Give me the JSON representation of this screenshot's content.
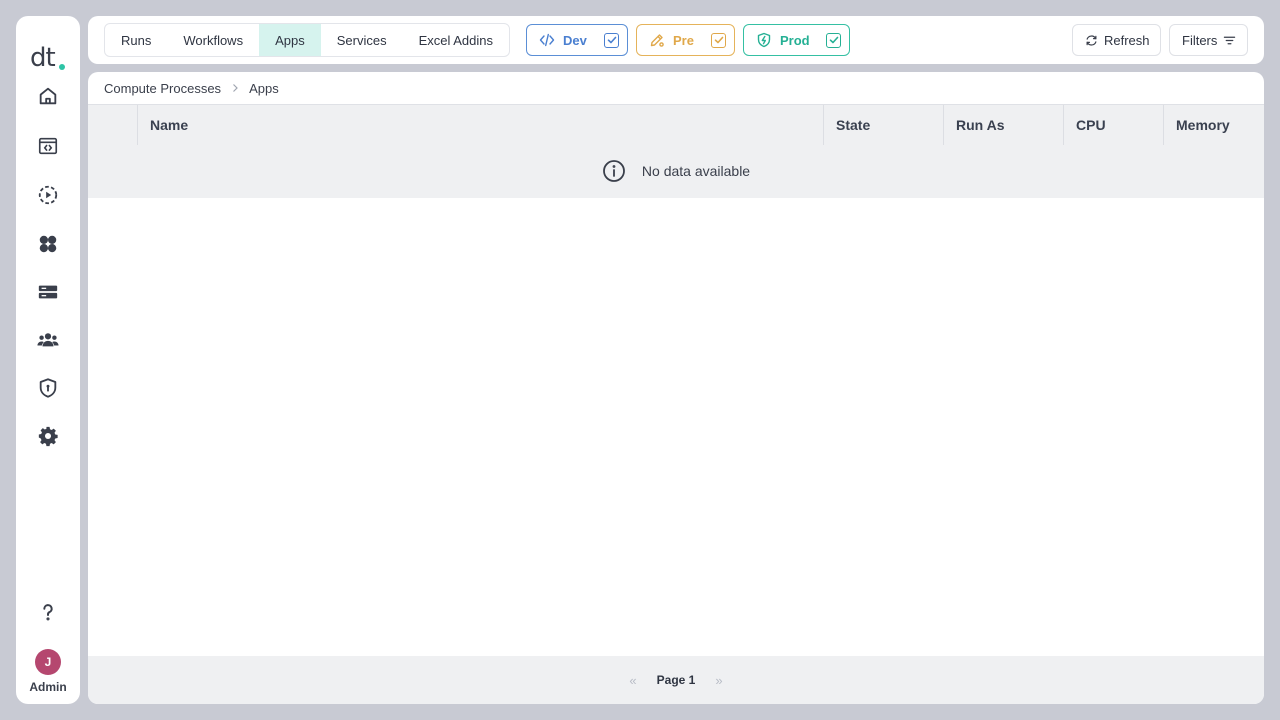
{
  "sidebar": {
    "logo_text": "dt",
    "items": [
      {
        "name": "home",
        "icon": "home-icon"
      },
      {
        "name": "code",
        "icon": "code-window-icon"
      },
      {
        "name": "runs",
        "icon": "play-circle-icon"
      },
      {
        "name": "apps",
        "icon": "apps-grid-icon"
      },
      {
        "name": "servers",
        "icon": "server-icon"
      },
      {
        "name": "users",
        "icon": "users-icon"
      },
      {
        "name": "security",
        "icon": "shield-keyhole-icon"
      },
      {
        "name": "settings",
        "icon": "gear-icon"
      }
    ],
    "help_icon": "question-icon",
    "user": {
      "initial": "J",
      "role": "Admin",
      "avatar_color": "#b5476f"
    }
  },
  "topbar": {
    "tabs": [
      {
        "label": "Runs",
        "active": false
      },
      {
        "label": "Workflows",
        "active": false
      },
      {
        "label": "Apps",
        "active": true
      },
      {
        "label": "Services",
        "active": false
      },
      {
        "label": "Excel Addins",
        "active": false
      }
    ],
    "environments": [
      {
        "label": "Dev",
        "checked": true,
        "color": "#4a7fd0",
        "icon": "code-icon"
      },
      {
        "label": "Pre",
        "checked": true,
        "color": "#e0a84a",
        "icon": "pencil-icon"
      },
      {
        "label": "Prod",
        "checked": true,
        "color": "#25b094",
        "icon": "shield-bolt-icon"
      }
    ],
    "refresh_label": "Refresh",
    "filters_label": "Filters"
  },
  "breadcrumb": [
    "Compute Processes",
    "Apps"
  ],
  "table": {
    "columns": [
      "Name",
      "State",
      "Run As",
      "CPU",
      "Memory"
    ],
    "empty_message": "No data available"
  },
  "pagination": {
    "label": "Page 1"
  }
}
